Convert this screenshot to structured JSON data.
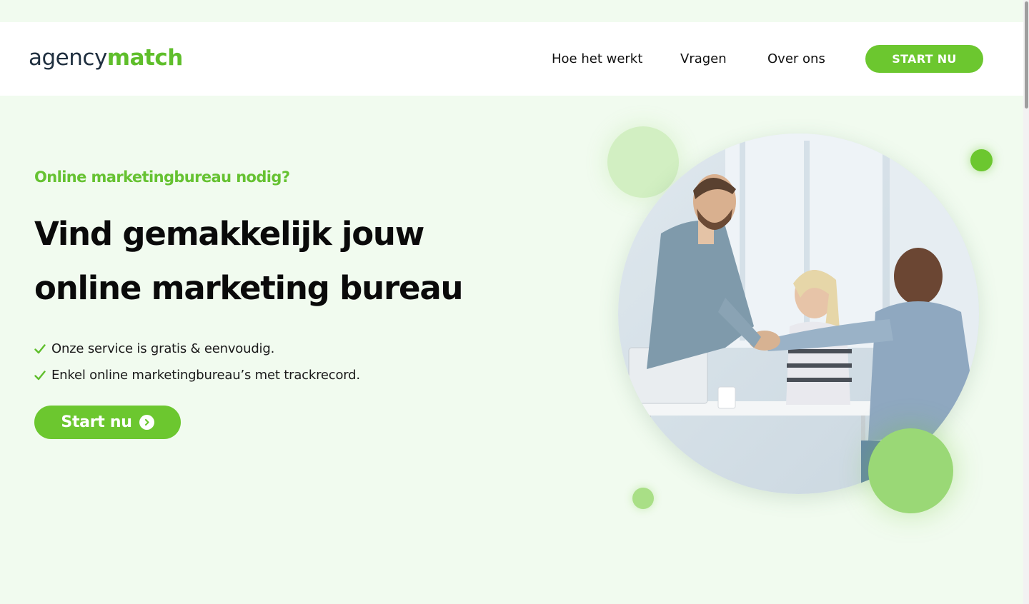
{
  "header": {
    "logo": {
      "part1": "agency",
      "part2": "match"
    },
    "nav": [
      {
        "label": "Hoe het werkt"
      },
      {
        "label": "Vragen"
      },
      {
        "label": "Over ons"
      }
    ],
    "cta_label": "START NU"
  },
  "hero": {
    "eyebrow": "Online marketingbureau nodig?",
    "headline_line1": "Vind gemakkelijk jouw",
    "headline_line2": "online marketing bureau",
    "bullets": [
      {
        "text": "Onze service is gratis & eenvoudig."
      },
      {
        "text": "Enkel online marketingbureau’s met trackrecord."
      }
    ],
    "cta_label": "Start nu",
    "cta_icon": "chevron-right-circle-icon",
    "bullet_icon": "check-icon",
    "image": "business-handshake-photo"
  },
  "colors": {
    "accent": "#6cc72f",
    "background": "#f1fbef",
    "header_bg": "#ffffff",
    "text_dark": "#0a0a0a",
    "logo_dark": "#1f2f3f"
  }
}
